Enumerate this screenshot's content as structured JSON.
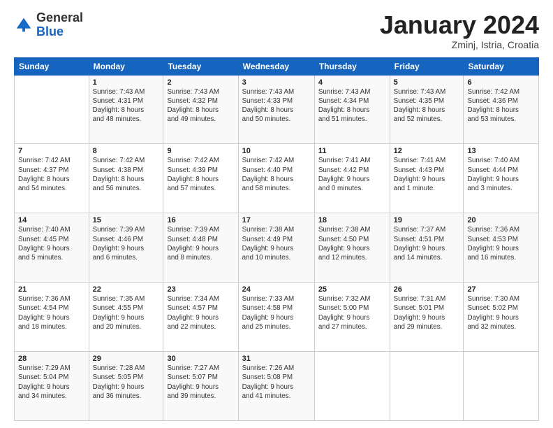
{
  "header": {
    "logo": {
      "general": "General",
      "blue": "Blue"
    },
    "title": "January 2024",
    "subtitle": "Zminj, Istria, Croatia"
  },
  "weekdays": [
    "Sunday",
    "Monday",
    "Tuesday",
    "Wednesday",
    "Thursday",
    "Friday",
    "Saturday"
  ],
  "weeks": [
    [
      {
        "day": "",
        "info": ""
      },
      {
        "day": "1",
        "info": "Sunrise: 7:43 AM\nSunset: 4:31 PM\nDaylight: 8 hours\nand 48 minutes."
      },
      {
        "day": "2",
        "info": "Sunrise: 7:43 AM\nSunset: 4:32 PM\nDaylight: 8 hours\nand 49 minutes."
      },
      {
        "day": "3",
        "info": "Sunrise: 7:43 AM\nSunset: 4:33 PM\nDaylight: 8 hours\nand 50 minutes."
      },
      {
        "day": "4",
        "info": "Sunrise: 7:43 AM\nSunset: 4:34 PM\nDaylight: 8 hours\nand 51 minutes."
      },
      {
        "day": "5",
        "info": "Sunrise: 7:43 AM\nSunset: 4:35 PM\nDaylight: 8 hours\nand 52 minutes."
      },
      {
        "day": "6",
        "info": "Sunrise: 7:42 AM\nSunset: 4:36 PM\nDaylight: 8 hours\nand 53 minutes."
      }
    ],
    [
      {
        "day": "7",
        "info": "Sunrise: 7:42 AM\nSunset: 4:37 PM\nDaylight: 8 hours\nand 54 minutes."
      },
      {
        "day": "8",
        "info": "Sunrise: 7:42 AM\nSunset: 4:38 PM\nDaylight: 8 hours\nand 56 minutes."
      },
      {
        "day": "9",
        "info": "Sunrise: 7:42 AM\nSunset: 4:39 PM\nDaylight: 8 hours\nand 57 minutes."
      },
      {
        "day": "10",
        "info": "Sunrise: 7:42 AM\nSunset: 4:40 PM\nDaylight: 8 hours\nand 58 minutes."
      },
      {
        "day": "11",
        "info": "Sunrise: 7:41 AM\nSunset: 4:42 PM\nDaylight: 9 hours\nand 0 minutes."
      },
      {
        "day": "12",
        "info": "Sunrise: 7:41 AM\nSunset: 4:43 PM\nDaylight: 9 hours\nand 1 minute."
      },
      {
        "day": "13",
        "info": "Sunrise: 7:40 AM\nSunset: 4:44 PM\nDaylight: 9 hours\nand 3 minutes."
      }
    ],
    [
      {
        "day": "14",
        "info": "Sunrise: 7:40 AM\nSunset: 4:45 PM\nDaylight: 9 hours\nand 5 minutes."
      },
      {
        "day": "15",
        "info": "Sunrise: 7:39 AM\nSunset: 4:46 PM\nDaylight: 9 hours\nand 6 minutes."
      },
      {
        "day": "16",
        "info": "Sunrise: 7:39 AM\nSunset: 4:48 PM\nDaylight: 9 hours\nand 8 minutes."
      },
      {
        "day": "17",
        "info": "Sunrise: 7:38 AM\nSunset: 4:49 PM\nDaylight: 9 hours\nand 10 minutes."
      },
      {
        "day": "18",
        "info": "Sunrise: 7:38 AM\nSunset: 4:50 PM\nDaylight: 9 hours\nand 12 minutes."
      },
      {
        "day": "19",
        "info": "Sunrise: 7:37 AM\nSunset: 4:51 PM\nDaylight: 9 hours\nand 14 minutes."
      },
      {
        "day": "20",
        "info": "Sunrise: 7:36 AM\nSunset: 4:53 PM\nDaylight: 9 hours\nand 16 minutes."
      }
    ],
    [
      {
        "day": "21",
        "info": "Sunrise: 7:36 AM\nSunset: 4:54 PM\nDaylight: 9 hours\nand 18 minutes."
      },
      {
        "day": "22",
        "info": "Sunrise: 7:35 AM\nSunset: 4:55 PM\nDaylight: 9 hours\nand 20 minutes."
      },
      {
        "day": "23",
        "info": "Sunrise: 7:34 AM\nSunset: 4:57 PM\nDaylight: 9 hours\nand 22 minutes."
      },
      {
        "day": "24",
        "info": "Sunrise: 7:33 AM\nSunset: 4:58 PM\nDaylight: 9 hours\nand 25 minutes."
      },
      {
        "day": "25",
        "info": "Sunrise: 7:32 AM\nSunset: 5:00 PM\nDaylight: 9 hours\nand 27 minutes."
      },
      {
        "day": "26",
        "info": "Sunrise: 7:31 AM\nSunset: 5:01 PM\nDaylight: 9 hours\nand 29 minutes."
      },
      {
        "day": "27",
        "info": "Sunrise: 7:30 AM\nSunset: 5:02 PM\nDaylight: 9 hours\nand 32 minutes."
      }
    ],
    [
      {
        "day": "28",
        "info": "Sunrise: 7:29 AM\nSunset: 5:04 PM\nDaylight: 9 hours\nand 34 minutes."
      },
      {
        "day": "29",
        "info": "Sunrise: 7:28 AM\nSunset: 5:05 PM\nDaylight: 9 hours\nand 36 minutes."
      },
      {
        "day": "30",
        "info": "Sunrise: 7:27 AM\nSunset: 5:07 PM\nDaylight: 9 hours\nand 39 minutes."
      },
      {
        "day": "31",
        "info": "Sunrise: 7:26 AM\nSunset: 5:08 PM\nDaylight: 9 hours\nand 41 minutes."
      },
      {
        "day": "",
        "info": ""
      },
      {
        "day": "",
        "info": ""
      },
      {
        "day": "",
        "info": ""
      }
    ]
  ]
}
